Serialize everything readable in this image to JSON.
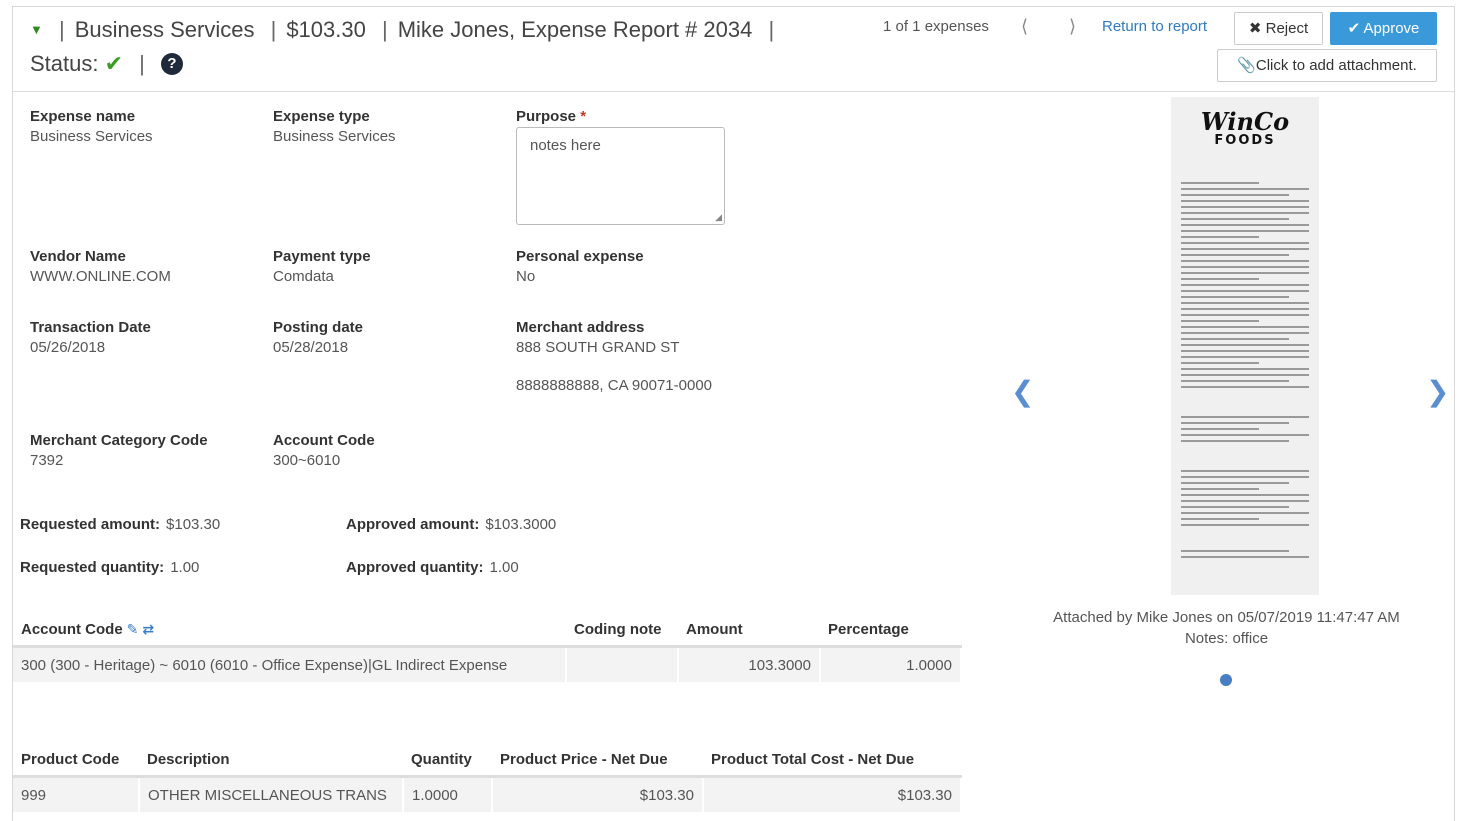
{
  "header": {
    "expense_name": "Business Services",
    "amount": "$103.30",
    "report": "Mike Jones, Expense Report # 2034",
    "status_label": "Status:",
    "status_icon": "check-icon",
    "help_icon": "question-icon"
  },
  "nav": {
    "count": "1 of 1 expenses",
    "prev_icon": "chevron-left-icon",
    "next_icon": "chevron-right-icon",
    "return_label": "Return to report"
  },
  "actions": {
    "reject_label": "Reject",
    "approve_label": "Approve",
    "attach_label": "Click to add attachment."
  },
  "fields": {
    "expense_name": {
      "label": "Expense name",
      "value": "Business Services"
    },
    "expense_type": {
      "label": "Expense type",
      "value": "Business Services"
    },
    "purpose": {
      "label": "Purpose",
      "required_mark": "*",
      "value": "notes here"
    },
    "vendor_name": {
      "label": "Vendor Name",
      "value": "WWW.ONLINE.COM"
    },
    "payment_type": {
      "label": "Payment type",
      "value": "Comdata"
    },
    "personal_expense": {
      "label": "Personal expense",
      "value": "No"
    },
    "transaction_date": {
      "label": "Transaction Date",
      "value": "05/26/2018"
    },
    "posting_date": {
      "label": "Posting date",
      "value": "05/28/2018"
    },
    "merchant_address": {
      "label": "Merchant address",
      "line1": "888 SOUTH GRAND ST",
      "line2": "8888888888, CA 90071-0000"
    },
    "merchant_category_code": {
      "label": "Merchant Category Code",
      "value": "7392"
    },
    "account_code": {
      "label": "Account Code",
      "value": "300~6010"
    }
  },
  "amounts": {
    "requested_amount": {
      "label": "Requested amount:",
      "value": "$103.30"
    },
    "approved_amount": {
      "label": "Approved amount:",
      "value": "$103.3000"
    },
    "requested_quantity": {
      "label": "Requested quantity:",
      "value": "1.00"
    },
    "approved_quantity": {
      "label": "Approved quantity:",
      "value": "1.00"
    }
  },
  "coding_table": {
    "headers": [
      "Account Code",
      "Coding note",
      "Amount",
      "Percentage"
    ],
    "rows": [
      {
        "account": "300 (300 - Heritage) ~ 6010 (6010 - Office Expense)|GL Indirect Expense",
        "note": "",
        "amount": "103.3000",
        "percentage": "1.0000"
      }
    ]
  },
  "product_table": {
    "headers": [
      "Product Code",
      "Description",
      "Quantity",
      "Product Price - Net Due",
      "Product Total Cost - Net Due"
    ],
    "rows": [
      {
        "code": "999",
        "description": "OTHER MISCELLANEOUS TRANS",
        "quantity": "1.0000",
        "price": "$103.30",
        "total": "$103.30"
      }
    ]
  },
  "attachment": {
    "receipt_brand": "WinCo",
    "receipt_brand2": "FOODS",
    "caption": "Attached by Mike Jones on 05/07/2019 11:47:47 AM",
    "notes": "Notes: office"
  }
}
